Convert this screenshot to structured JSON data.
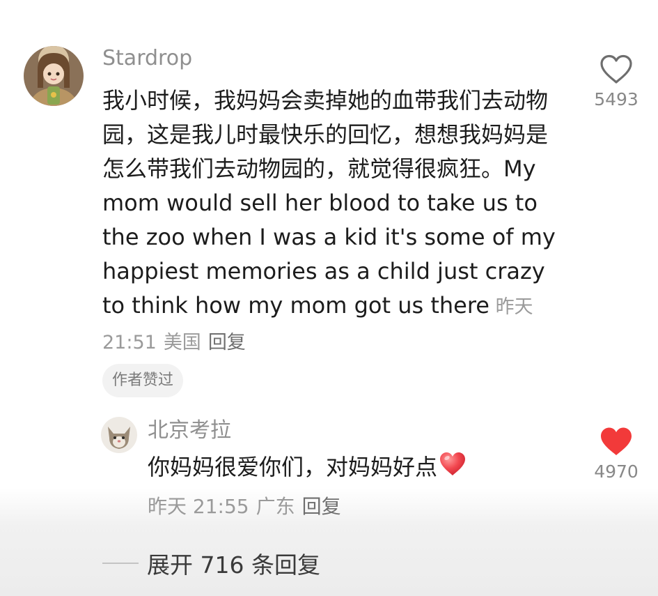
{
  "comment": {
    "username": "Stardrop",
    "text": "我小时候，我妈妈会卖掉她的血带我们去动物园，这是我儿时最快乐的回忆，想想我妈妈是怎么带我们去动物园的，就觉得很疯狂。My mom would sell her blood to take us to the zoo when I was a kid it's some of my happiest memories as a child just crazy to think how my mom got us there",
    "time": "昨天 21:51",
    "location": "美国",
    "reply_label": "回复",
    "author_badge": "作者赞过",
    "like_count": "5493",
    "liked": false
  },
  "reply": {
    "username": "北京考拉",
    "text": "你妈妈很爱你们，对妈妈好点",
    "emoji": "red-heart",
    "time": "昨天 21:55",
    "location": "广东",
    "reply_label": "回复",
    "like_count": "4970",
    "liked": true
  },
  "expand": {
    "label": "展开 716 条回复"
  },
  "colors": {
    "liked_heart": "#f23a3a",
    "outline_heart": "#6e6e6e",
    "meta_text": "#9a9a9a",
    "username": "#8f8f8f"
  }
}
